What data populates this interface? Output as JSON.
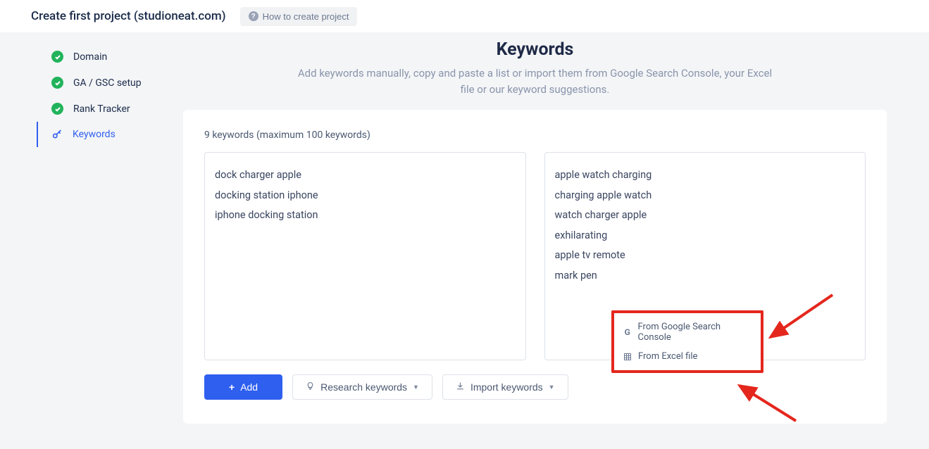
{
  "header": {
    "title": "Create first project (studioneat.com)",
    "help_label": "How to create project"
  },
  "sidebar": {
    "items": [
      {
        "label": "Domain",
        "done": true
      },
      {
        "label": "GA / GSC setup",
        "done": true
      },
      {
        "label": "Rank Tracker",
        "done": true
      },
      {
        "label": "Keywords",
        "active": true
      }
    ]
  },
  "page": {
    "title": "Keywords",
    "subtitle": "Add keywords manually, copy and paste a list or import them from Google Search Console, your Excel file or our keyword suggestions."
  },
  "keywords": {
    "counter": "9 keywords (maximum 100 keywords)",
    "left": [
      "dock charger apple",
      "docking station iphone",
      "iphone docking station"
    ],
    "right": [
      "apple watch charging",
      "charging apple watch",
      "watch charger apple",
      "exhilarating",
      "apple tv remote",
      "mark pen"
    ]
  },
  "buttons": {
    "add": "Add",
    "research": "Research keywords",
    "import": "Import keywords"
  },
  "popup": {
    "gsc": "From Google Search Console",
    "excel": "From Excel file"
  }
}
